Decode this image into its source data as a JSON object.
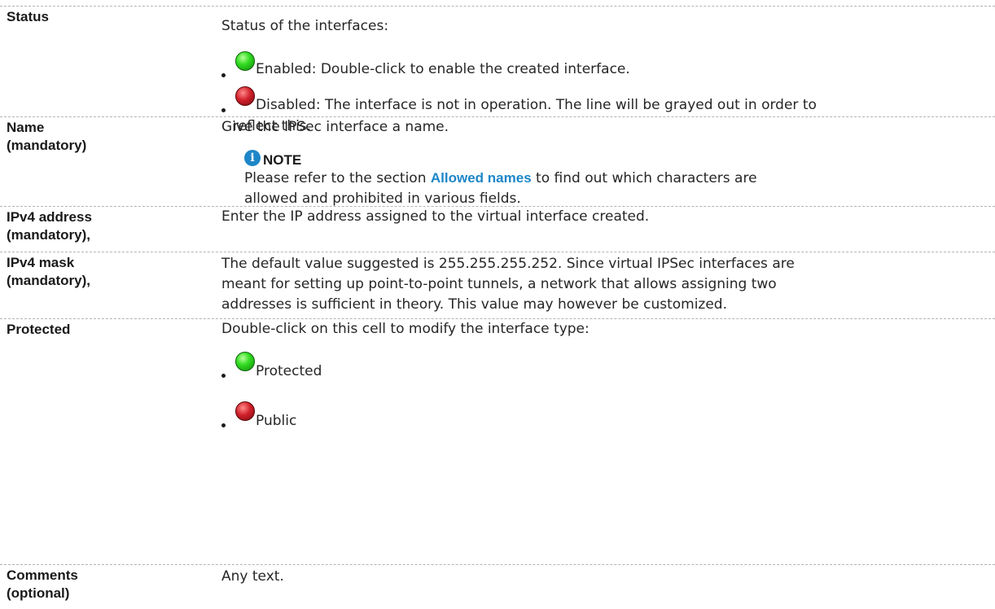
{
  "rows": [
    {
      "label": [
        "Status"
      ],
      "intro": "Status of the interfaces:",
      "bullets": [
        {
          "icon": "green-led-icon",
          "lines": [
            "Enabled: Double-click to enable the created interface."
          ]
        },
        {
          "icon": "red-led-icon",
          "lines": [
            "Disabled: The interface is not in operation. The line will be grayed out in order to",
            "reflect this."
          ]
        }
      ]
    },
    {
      "label": [
        "Name",
        "(mandatory)"
      ],
      "intro": "Give the IPSec interface a name.",
      "note": {
        "heading": "NOTE",
        "line1_before": "Please refer to the section ",
        "line1_link": "Allowed names",
        "line1_after": " to find out which characters are",
        "line2": "allowed and prohibited in various fields."
      }
    },
    {
      "label": [
        "IPv4 address",
        "(mandatory),"
      ],
      "lines": [
        "Enter the IP address assigned to the virtual interface created."
      ]
    },
    {
      "label": [
        "IPv4 mask",
        "(mandatory),"
      ],
      "lines": [
        "The default value suggested is 255.255.255.252. Since virtual IPSec interfaces are",
        "meant for setting up point-to-point tunnels, a network that allows assigning two",
        "addresses is sufficient in theory. This value may however be customized."
      ]
    },
    {
      "label": [
        "Protected"
      ],
      "intro": "Double-click on this cell to modify the interface type:",
      "bullets": [
        {
          "icon": "green-led-icon",
          "lines": [
            "Protected"
          ]
        },
        {
          "icon": "red-led-icon",
          "lines": [
            "Public"
          ]
        }
      ]
    },
    {
      "label": [
        "Comments",
        "(optional)"
      ],
      "lines": [
        "Any text."
      ]
    }
  ],
  "colors": {
    "link": "#1e86c8",
    "enabled": "#33dd22",
    "disabled": "#d0202a",
    "divider": "#b4b4b4"
  }
}
